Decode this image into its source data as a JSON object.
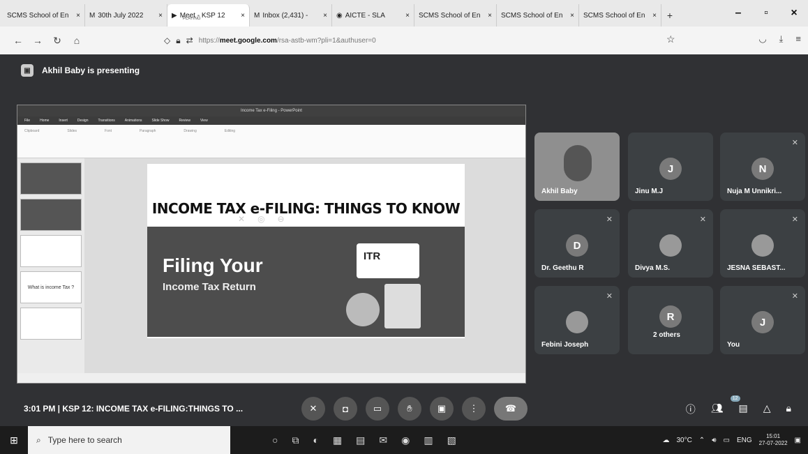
{
  "browser": {
    "tabs": [
      {
        "label": "SCMS School of En",
        "icon": "page-icon",
        "close": "×"
      },
      {
        "label": "30th July 2022",
        "icon": "gmail-icon",
        "close": "×"
      },
      {
        "label": "Meet - KSP 12",
        "sub": "PLAYING",
        "icon": "meet-icon",
        "close": "×",
        "active": true
      },
      {
        "label": "Inbox (2,431) -",
        "icon": "gmail-icon",
        "close": "×"
      },
      {
        "label": "AICTE - SLA",
        "icon": "globe-icon",
        "close": "×"
      },
      {
        "label": "SCMS School of En",
        "icon": "page-icon",
        "close": "×"
      },
      {
        "label": "SCMS School of En",
        "icon": "page-icon",
        "close": "×"
      },
      {
        "label": "SCMS School of En",
        "icon": "page-icon",
        "close": "×"
      }
    ],
    "new_tab": "+",
    "url_prefix": "https://",
    "url_host": "meet.google.com",
    "url_rest": "/rsa-astb-wm?pli=1&authuser=0"
  },
  "meet": {
    "presenting_text": "Akhil Baby is presenting",
    "meeting_info": "3:01 PM  |  KSP 12: INCOME TAX e-FILING:THINGS TO ...",
    "participant_badge": "12",
    "tiles": [
      {
        "name": "Akhil Baby",
        "initial": "",
        "video": true
      },
      {
        "name": "Jinu M.J",
        "initial": "J"
      },
      {
        "name": "Nuja M Unnikri...",
        "initial": "N",
        "muted": true
      },
      {
        "name": "Dr. Geethu R",
        "initial": "D",
        "muted": true
      },
      {
        "name": "Divya M.S.",
        "initial": "",
        "muted": true,
        "photo": true
      },
      {
        "name": "JESNA SEBAST...",
        "initial": "",
        "muted": true,
        "photo": true
      },
      {
        "name": "Febini Joseph",
        "initial": "",
        "muted": true,
        "photo": true
      },
      {
        "name": "2 others",
        "initial": "R",
        "muted": false
      },
      {
        "name": "You",
        "initial": "J",
        "muted": true
      }
    ]
  },
  "slide": {
    "title": "INCOME TAX e-FILING: THINGS TO KNOW",
    "banner_h1": "Filing Your",
    "banner_h2": "Income Tax Return",
    "itr_label": "ITR",
    "thumb_4": "What is income Tax ?",
    "ppt_title": "Income Tax e-Filing - PowerPoint"
  },
  "taskbar": {
    "search_placeholder": "Type here to search",
    "temperature": "30°C",
    "lang": "ENG",
    "time": "15:01",
    "date": "27-07-2022"
  }
}
